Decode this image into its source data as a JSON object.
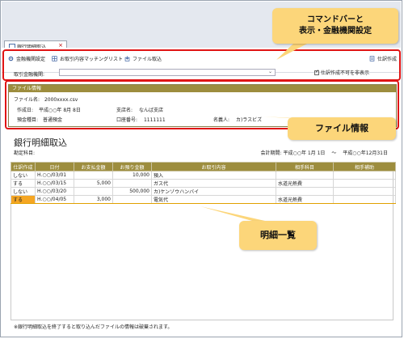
{
  "tab": {
    "label": "銀行明細取込",
    "close": "×"
  },
  "toolbar": {
    "bank_settings": "金融機関設定",
    "matching_list": "お取引内容マッチングリスト",
    "file_import": "ファイル取込",
    "journal_entry": "仕訳作成"
  },
  "account": {
    "label": "取引金融機関:",
    "value": "",
    "hide_label": "仕訳作成不可を非表示"
  },
  "file_info": {
    "header": "ファイル情報",
    "file_name_label": "ファイル名:",
    "file_name": "2000xxxx.csv",
    "created_label": "作成日:",
    "created": "平成○○年 8月 8日",
    "branch_label": "支店名:",
    "branch": "なんば支店",
    "deposit_type_label": "預金種目:",
    "deposit_type": "普通預金",
    "account_no_label": "口座番号:",
    "account_no": "1111111",
    "holder_label": "名義人:",
    "holder": "カ)ラスビズ"
  },
  "list": {
    "title": "銀行明細取込",
    "ledger_label": "勘定科目:",
    "period_label": "会計期間:",
    "period_from": "平成○○年 1月 1日",
    "period_sep": "〜",
    "period_to": "平成○○年12月31日",
    "columns": [
      "仕訳作成",
      "日付",
      "お支払金額",
      "お預り金額",
      "お取引内容",
      "相手科目",
      "相手補助"
    ],
    "rows": [
      [
        "しない",
        "H.○○/03/01",
        "",
        "10,000",
        "預入",
        "",
        ""
      ],
      [
        "する",
        "H.○○/03/15",
        "5,000",
        "",
        "ガス代",
        "水道光熱費",
        ""
      ],
      [
        "しない",
        "H.○○/03/20",
        "",
        "500,000",
        "カ)ケンゾウハンバイ",
        "",
        ""
      ],
      [
        "する",
        "H.○○/04/05",
        "3,000",
        "",
        "電気代",
        "水道光熱費",
        ""
      ]
    ],
    "footer": "※銀行明細取込を終了すると取り込んだファイルの情報は破棄されます。"
  },
  "callouts": {
    "top_line1": "コマンドバーと",
    "top_line2": "表示・金融機関設定",
    "file_info": "ファイル情報",
    "list": "明細一覧"
  },
  "colors": {
    "accent": "#9d8d3e",
    "callout": "#fcd67a",
    "highlight": "#e01414",
    "selected": "#f5a623"
  },
  "icons": [
    "document-icon",
    "gear-icon",
    "grid-icon",
    "import-icon",
    "journal-icon",
    "chevron-down-icon",
    "close-icon"
  ]
}
